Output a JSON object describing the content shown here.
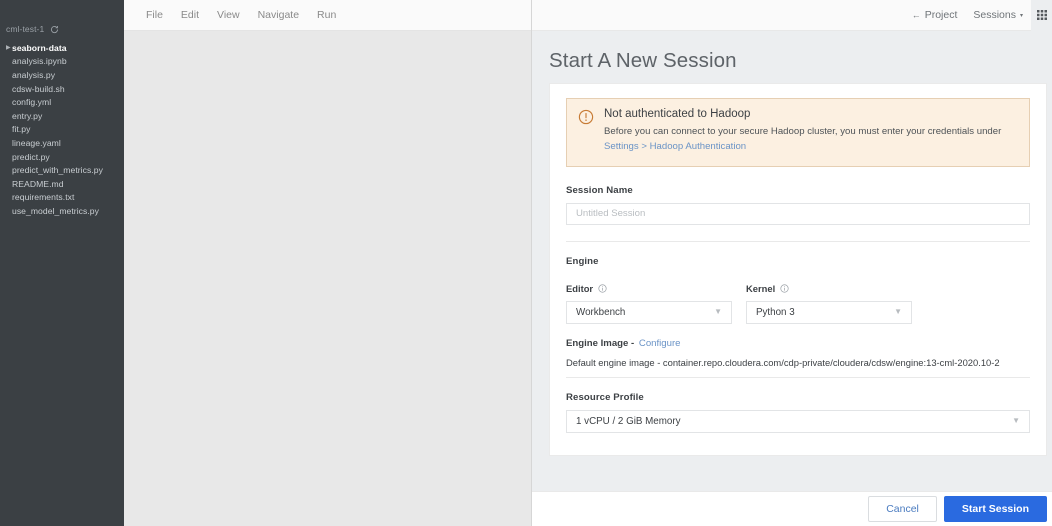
{
  "sidebar": {
    "project_name": "cml-test-1",
    "refresh_icon": "refresh-icon",
    "items": [
      {
        "label": "seaborn-data",
        "type": "folder"
      },
      {
        "label": "analysis.ipynb",
        "type": "file"
      },
      {
        "label": "analysis.py",
        "type": "file"
      },
      {
        "label": "cdsw-build.sh",
        "type": "file"
      },
      {
        "label": "config.yml",
        "type": "file"
      },
      {
        "label": "entry.py",
        "type": "file"
      },
      {
        "label": "fit.py",
        "type": "file"
      },
      {
        "label": "lineage.yaml",
        "type": "file"
      },
      {
        "label": "predict.py",
        "type": "file"
      },
      {
        "label": "predict_with_metrics.py",
        "type": "file"
      },
      {
        "label": "README.md",
        "type": "file"
      },
      {
        "label": "requirements.txt",
        "type": "file"
      },
      {
        "label": "use_model_metrics.py",
        "type": "file"
      }
    ]
  },
  "menubar": {
    "items": [
      {
        "label": "File"
      },
      {
        "label": "Edit"
      },
      {
        "label": "View"
      },
      {
        "label": "Navigate"
      },
      {
        "label": "Run"
      }
    ]
  },
  "topbar": {
    "project_link": "Project",
    "back_arrow": "←",
    "sessions_menu": "Sessions",
    "sessions_caret": "▾",
    "grid_icon": "apps-grid-icon"
  },
  "main": {
    "title": "Start A New Session",
    "alert": {
      "icon": "exclamation-circle-icon",
      "title": "Not authenticated to Hadoop",
      "body_prefix": "Before you can connect to your secure Hadoop cluster, you must enter your credentials under ",
      "link": "Settings > Hadoop Authentication"
    },
    "session_name": {
      "label": "Session Name",
      "value": "",
      "placeholder": "Untitled Session"
    },
    "engine": {
      "label": "Engine",
      "editor": {
        "label": "Editor",
        "info_icon": "info-circle-icon",
        "value": "Workbench",
        "caret": "⌄"
      },
      "kernel": {
        "label": "Kernel",
        "info_icon": "info-circle-icon",
        "value": "Python 3",
        "caret": "⌄"
      },
      "engine_image": {
        "label": "Engine Image -",
        "configure_link": "Configure",
        "value": "Default engine image - container.repo.cloudera.com/cdp-private/cloudera/cdsw/engine:13-cml-2020.10-2"
      }
    },
    "resource_profile": {
      "label": "Resource Profile",
      "value": "1 vCPU / 2 GiB Memory",
      "caret": "⌄"
    }
  },
  "footer": {
    "cancel_label": "Cancel",
    "start_label": "Start Session"
  },
  "colors": {
    "sidebar_bg": "#3b4044",
    "primary_button": "#2a6ae0",
    "link": "#6a93c6",
    "alert_bg": "#fcf0e1",
    "alert_border": "#e6cfb3",
    "alert_icon": "#c77b35"
  }
}
